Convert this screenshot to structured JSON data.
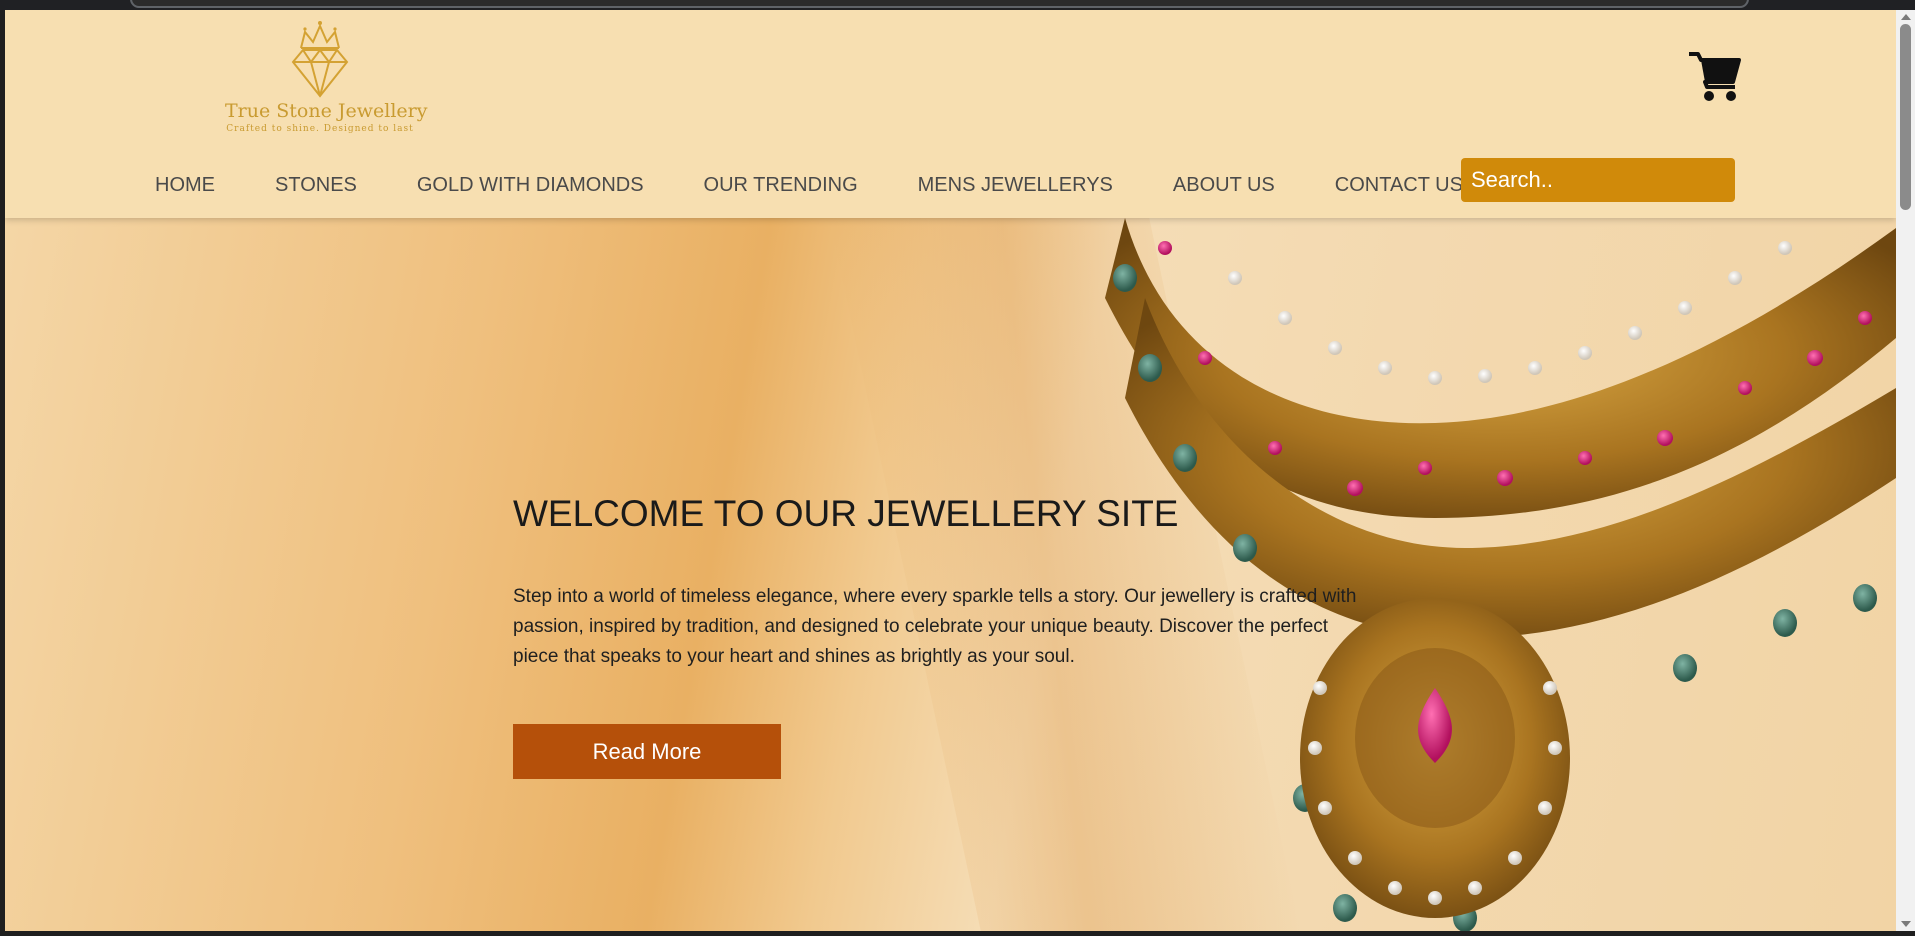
{
  "brand": {
    "name": "True Stone Jewellery",
    "tagline": "Crafted to shine. Designed to last"
  },
  "nav": {
    "items": [
      {
        "label": "HOME"
      },
      {
        "label": "STONES"
      },
      {
        "label": "GOLD WITH DIAMONDS"
      },
      {
        "label": "OUR TRENDING"
      },
      {
        "label": "MENS JEWELLERYS"
      },
      {
        "label": "ABOUT US"
      },
      {
        "label": "CONTACT US"
      }
    ]
  },
  "search": {
    "placeholder": "Search.."
  },
  "icons": {
    "cart": "shopping-cart-icon",
    "logo": "diamond-crown-logo"
  },
  "hero": {
    "title": "WELCOME TO OUR JEWELLERY SITE",
    "body": "Step into a world of timeless elegance, where every sparkle tells a story. Our jewellery is crafted with passion, inspired by tradition, and designed to celebrate your unique beauty. Discover the perfect piece that speaks to your heart and shines as brightly as your soul.",
    "cta": "Read More"
  },
  "colors": {
    "header_bg": "#f7dfb1",
    "accent_gold": "#c99b31",
    "search_bg": "#d08a0a",
    "button_bg": "#b5500a"
  }
}
